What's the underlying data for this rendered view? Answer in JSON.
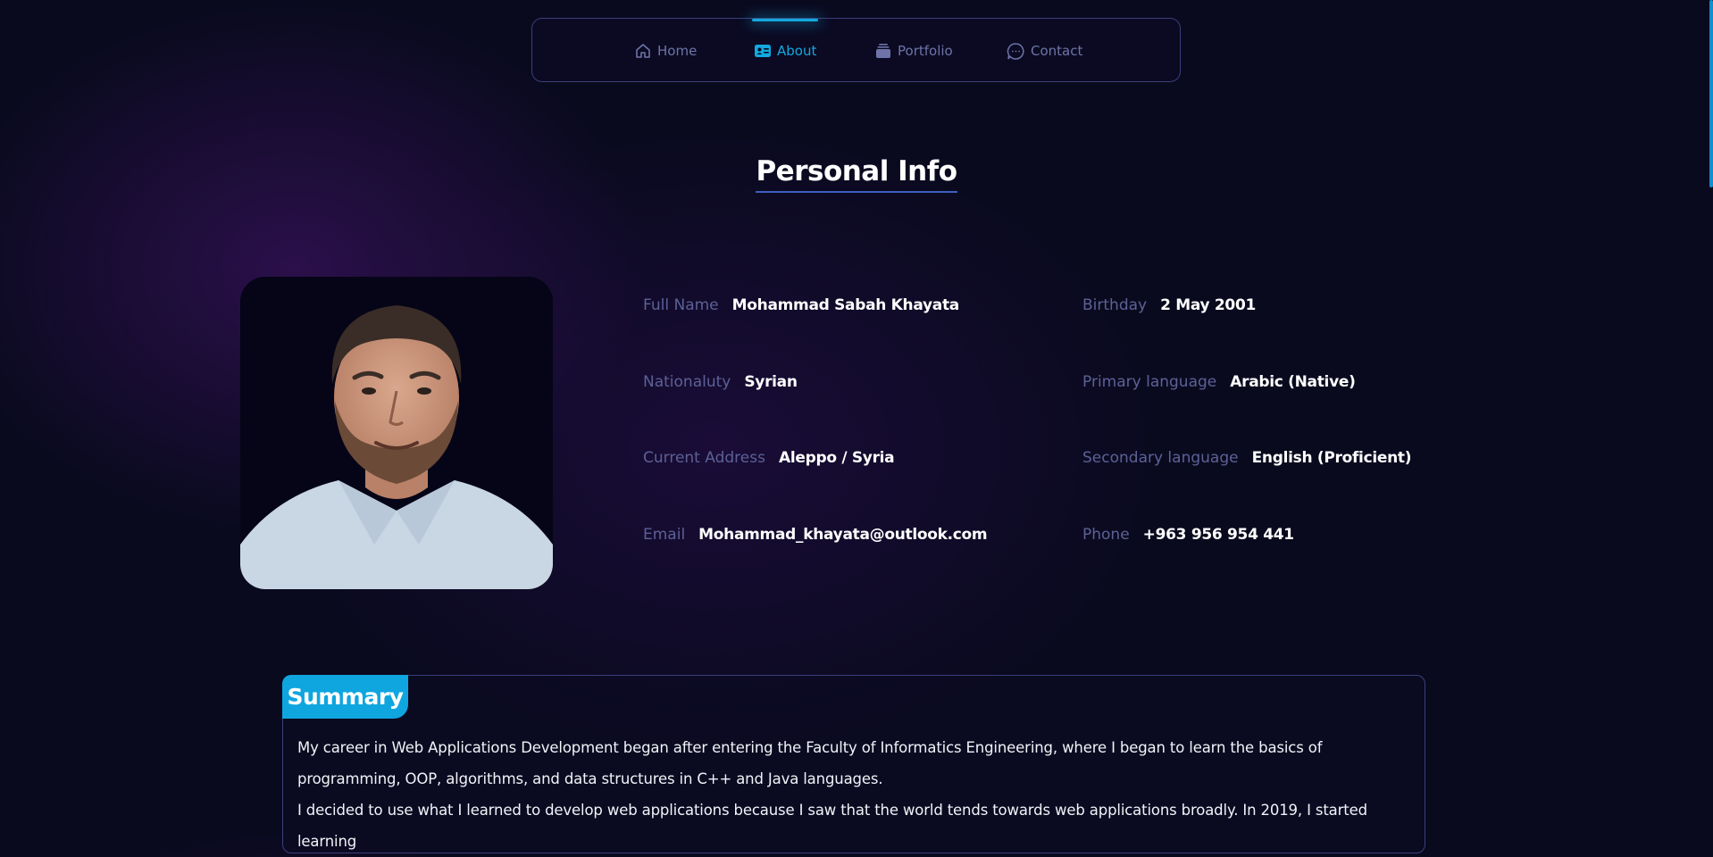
{
  "nav": {
    "items": [
      {
        "label": "Home",
        "icon": "home-icon"
      },
      {
        "label": "About",
        "icon": "id-card-icon",
        "active": true
      },
      {
        "label": "Portfolio",
        "icon": "portfolio-icon"
      },
      {
        "label": "Contact",
        "icon": "chat-bubble-icon"
      }
    ]
  },
  "page": {
    "title": "Personal Info"
  },
  "info": [
    {
      "label": "Full Name",
      "value": "Mohammad Sabah Khayata"
    },
    {
      "label": "Birthday",
      "value": "2 May 2001"
    },
    {
      "label": "Nationaluty",
      "value": "Syrian"
    },
    {
      "label": "Primary language",
      "value": "Arabic (Native)"
    },
    {
      "label": "Current Address",
      "value": "Aleppo / Syria"
    },
    {
      "label": "Secondary language",
      "value": "English (Proficient)"
    },
    {
      "label": "Email",
      "value": "Mohammad_khayata@outlook.com"
    },
    {
      "label": "Phone",
      "value": "+963 956 954 441"
    }
  ],
  "summary": {
    "title": "Summary",
    "paragraphs": [
      "My career in Web Applications Development began after entering the Faculty of Informatics Engineering, where I began to learn the basics of programming, OOP, algorithms, and data structures in C++ and Java languages.",
      "I decided to use what I learned to develop web applications because I saw that the world tends towards web applications broadly. In 2019, I started learning"
    ]
  },
  "colors": {
    "accent": "#13a9df",
    "background": "#0a0a1f",
    "border": "#3b3f7a",
    "label": "#5c6196"
  }
}
